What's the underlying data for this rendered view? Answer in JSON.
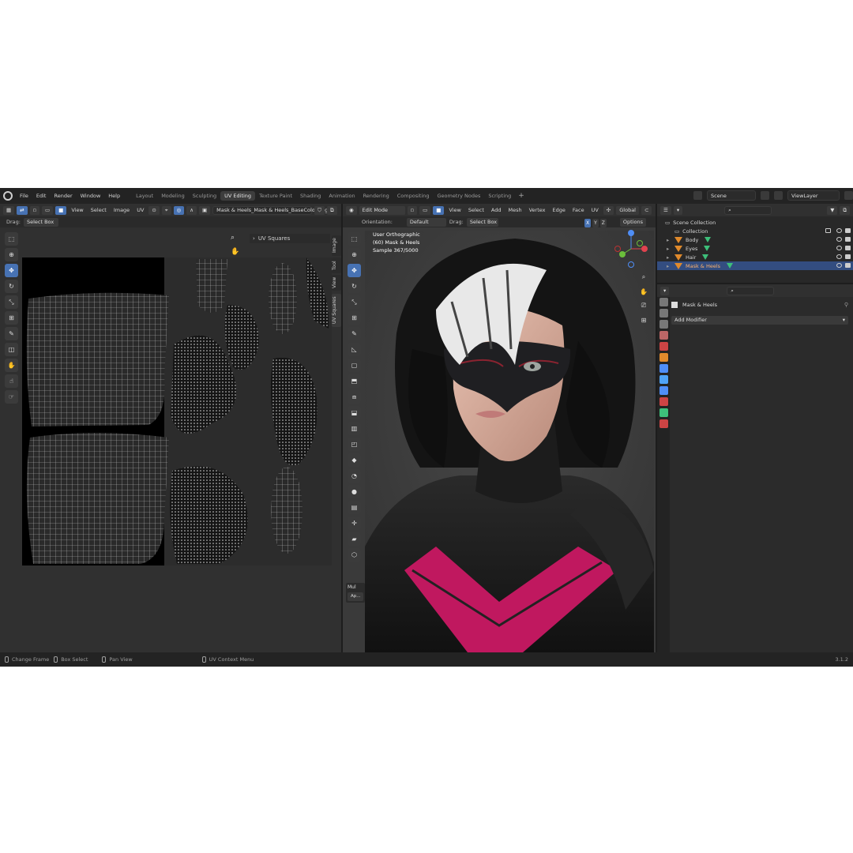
{
  "menus": [
    "File",
    "Edit",
    "Render",
    "Window",
    "Help"
  ],
  "workspaces": [
    {
      "label": "Layout",
      "active": false
    },
    {
      "label": "Modeling",
      "active": false
    },
    {
      "label": "Sculpting",
      "active": false
    },
    {
      "label": "UV Editing",
      "active": true
    },
    {
      "label": "Texture Paint",
      "active": false
    },
    {
      "label": "Shading",
      "active": false
    },
    {
      "label": "Animation",
      "active": false
    },
    {
      "label": "Rendering",
      "active": false
    },
    {
      "label": "Compositing",
      "active": false
    },
    {
      "label": "Geometry Nodes",
      "active": false
    },
    {
      "label": "Scripting",
      "active": false
    }
  ],
  "top_right": {
    "scene": "Scene",
    "view_layer": "ViewLayer"
  },
  "uv_editor": {
    "menus": [
      "View",
      "Select",
      "Image",
      "UV"
    ],
    "image_name": "Mask & Heels_Mask & Heels_BaseColor.png",
    "drag_label": "Drag:",
    "drag_value": "Select Box",
    "panel_title": "UV Squares",
    "side_tabs": [
      "Image",
      "Tool",
      "View",
      "UV Squares"
    ]
  },
  "viewport": {
    "mode": "Edit Mode",
    "menus": [
      "View",
      "Select",
      "Add",
      "Mesh",
      "Vertex",
      "Edge",
      "Face",
      "UV"
    ],
    "transform": "Global",
    "orientation_label": "Orientation:",
    "orientation_value": "Default",
    "drag_label": "Drag:",
    "drag_value": "Select Box",
    "options": "Options",
    "axes": [
      "X",
      "Y",
      "Z"
    ],
    "info_lines": [
      "User Orthographic",
      "(60) Mask & Heels",
      "Sample 367/5000"
    ],
    "last_op_short": "Mul",
    "last_op_btn": "Ap..."
  },
  "outliner": {
    "root": "Scene Collection",
    "collection": "Collection",
    "objects": [
      {
        "name": "Body",
        "selected": false
      },
      {
        "name": "Eyes",
        "selected": false
      },
      {
        "name": "Hair",
        "selected": false
      },
      {
        "name": "Mask & Heels",
        "selected": true
      }
    ]
  },
  "properties": {
    "object_name": "Mask & Heels",
    "add_modifier": "Add Modifier"
  },
  "statusbar": {
    "items": [
      "Change Frame",
      "Box Select",
      "Pan View",
      "UV Context Menu"
    ],
    "version": "3.1.2"
  },
  "colors": {
    "accent": "#4772b3",
    "selected_row": "#334d80",
    "mesh_icon": "#e08a2c",
    "mask_magenta": "#c0185f"
  }
}
